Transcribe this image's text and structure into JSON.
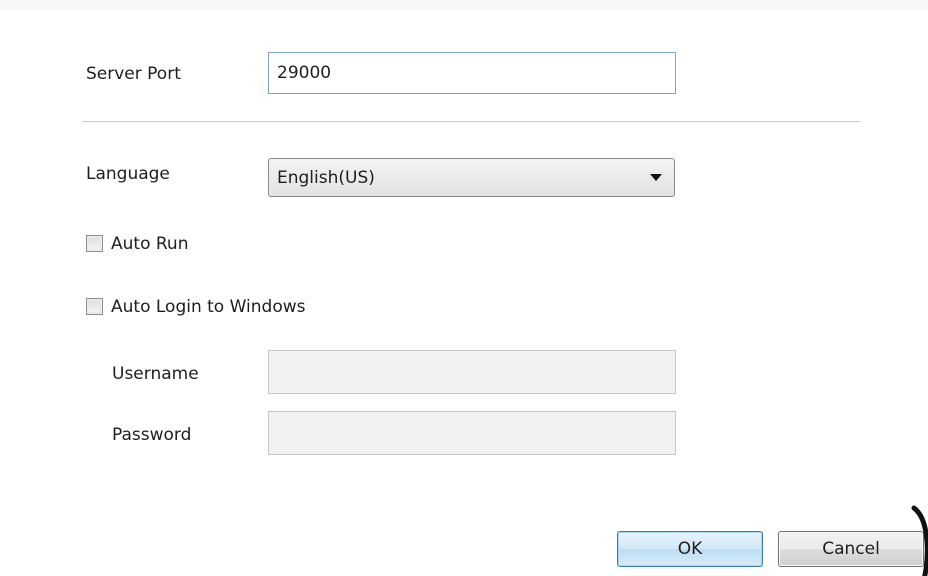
{
  "server_port": {
    "label": "Server Port",
    "value": "29000"
  },
  "language": {
    "label": "Language",
    "selected": "English(US)"
  },
  "auto_run": {
    "label": "Auto Run",
    "checked": false
  },
  "auto_login": {
    "label": "Auto Login to Windows",
    "checked": false
  },
  "username": {
    "label": "Username",
    "value": ""
  },
  "password": {
    "label": "Password",
    "value": ""
  },
  "buttons": {
    "ok": "OK",
    "cancel": "Cancel"
  },
  "colors": {
    "ok_button_border": "#3c7fb1",
    "input_border": "#7fa3d0",
    "disabled_input_bg": "#f2f2f2"
  }
}
